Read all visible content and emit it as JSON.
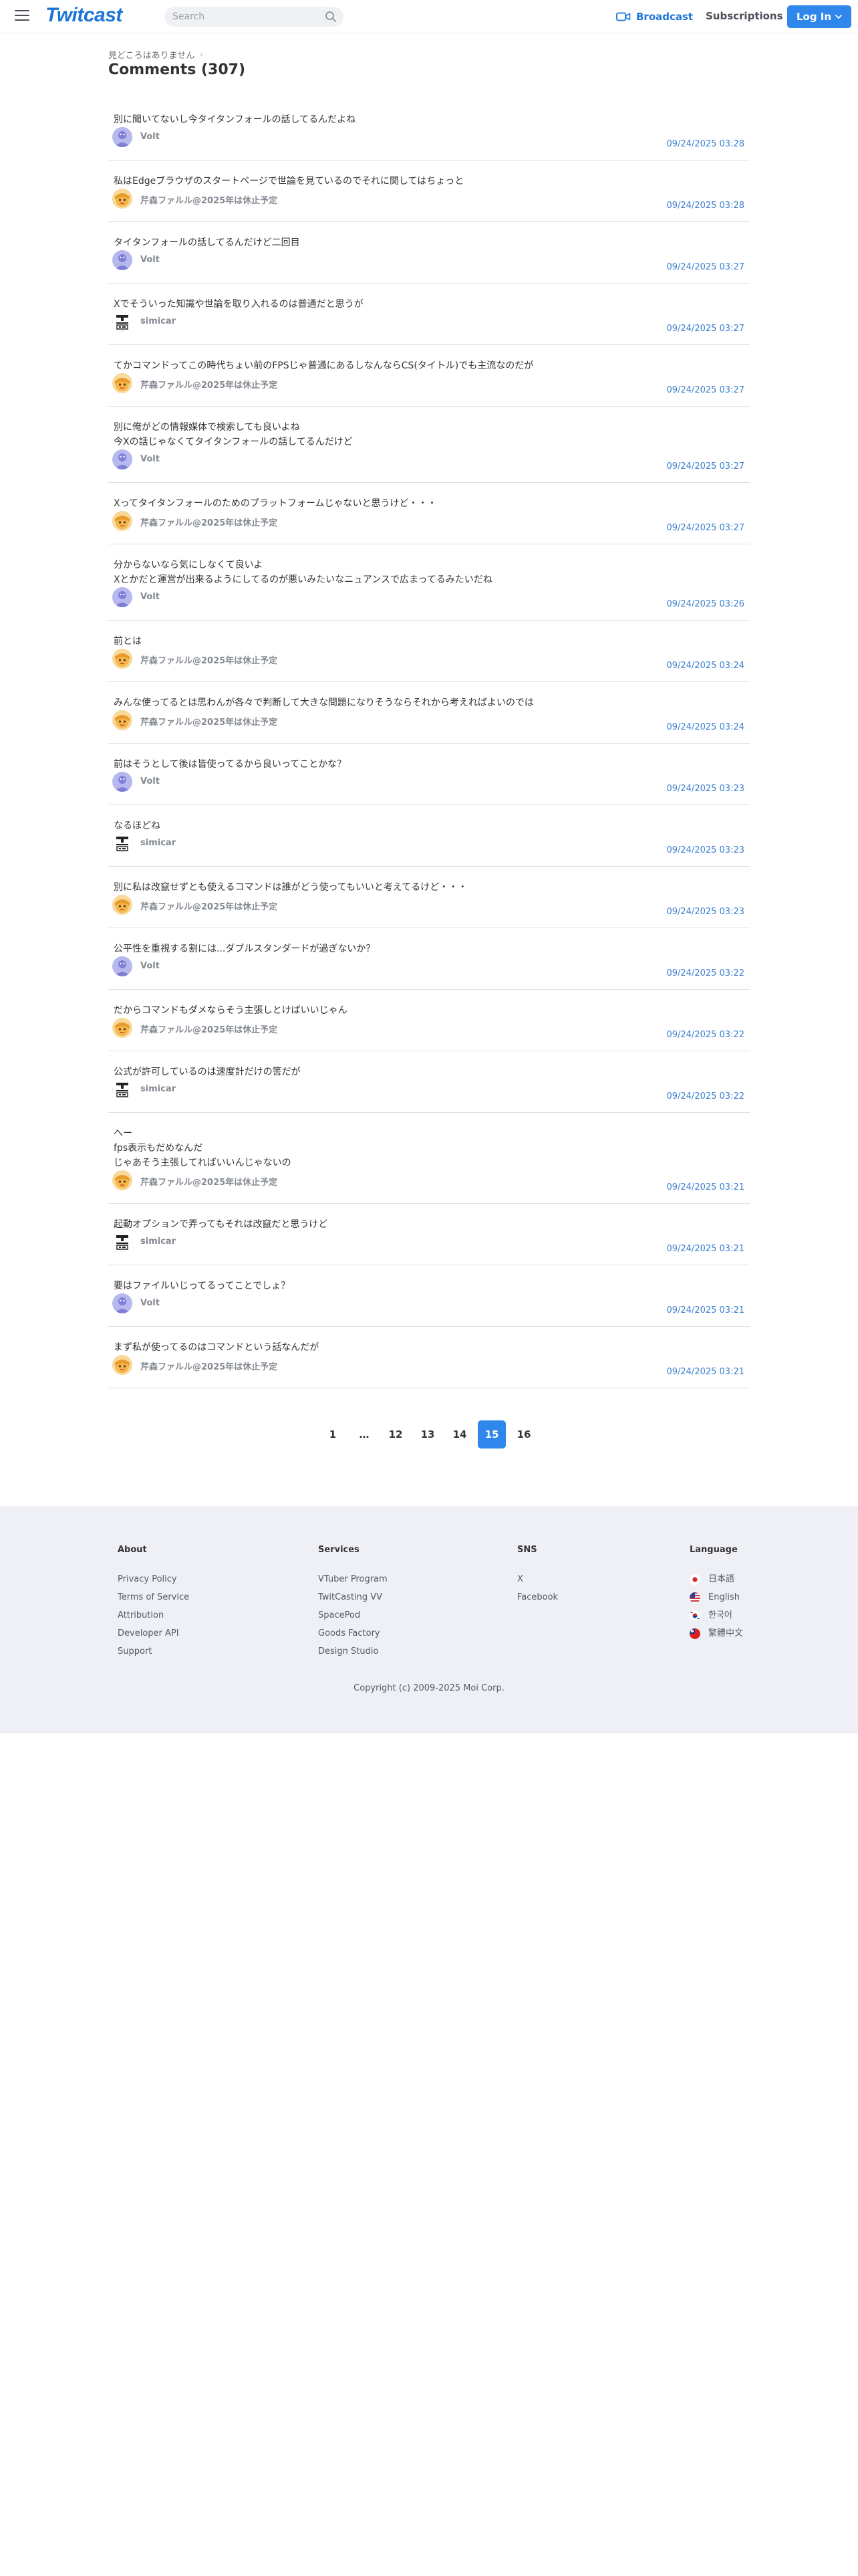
{
  "header": {
    "logo": "Twitcast",
    "search_placeholder": "Search",
    "broadcast_label": "Broadcast",
    "subscriptions_label": "Subscriptions",
    "login_label": "Log In"
  },
  "breadcrumb": {
    "label": "見どころはありません"
  },
  "page_title": "Comments (307)",
  "comments": [
    {
      "text": "別に聞いてないし今タイタンフォールの話してるんだよね",
      "user": "Volt",
      "avatar": "volt",
      "time": "09/24/2025 03:28"
    },
    {
      "text": "私はEdgeブラウザのスタートページで世論を見ているのでそれに関してはちょっと",
      "user": "芹森ファルル@2025年は休止予定",
      "avatar": "faruru",
      "time": "09/24/2025 03:28"
    },
    {
      "text": "タイタンフォールの話してるんだけど二回目",
      "user": "Volt",
      "avatar": "volt",
      "time": "09/24/2025 03:27"
    },
    {
      "text": "Xでそういった知識や世論を取り入れるのは普通だと思うが",
      "user": "simicar",
      "avatar": "simicar",
      "time": "09/24/2025 03:27"
    },
    {
      "text": "てかコマンドってこの時代ちょい前のFPSじゃ普通にあるしなんならCS(タイトル)でも主流なのだが",
      "user": "芹森ファルル@2025年は休止予定",
      "avatar": "faruru",
      "time": "09/24/2025 03:27"
    },
    {
      "text": "別に俺がどの情報媒体で検索しても良いよね\n今Xの話じゃなくてタイタンフォールの話してるんだけど",
      "user": "Volt",
      "avatar": "volt",
      "time": "09/24/2025 03:27"
    },
    {
      "text": "Xってタイタンフォールのためのプラットフォームじゃないと思うけど・・・",
      "user": "芹森ファルル@2025年は休止予定",
      "avatar": "faruru",
      "time": "09/24/2025 03:27"
    },
    {
      "text": "分からないなら気にしなくて良いよ\nXとかだと運営が出来るようにしてるのが悪いみたいなニュアンスで広まってるみたいだね",
      "user": "Volt",
      "avatar": "volt",
      "time": "09/24/2025 03:26"
    },
    {
      "text": "前とは",
      "user": "芹森ファルル@2025年は休止予定",
      "avatar": "faruru",
      "time": "09/24/2025 03:24"
    },
    {
      "text": "みんな使ってるとは思わんが各々で判断して大きな問題になりそうならそれから考えればよいのでは",
      "user": "芹森ファルル@2025年は休止予定",
      "avatar": "faruru",
      "time": "09/24/2025 03:24"
    },
    {
      "text": "前はそうとして後は皆使ってるから良いってことかな？",
      "user": "Volt",
      "avatar": "volt",
      "time": "09/24/2025 03:23"
    },
    {
      "text": "なるほどね",
      "user": "simicar",
      "avatar": "simicar",
      "time": "09/24/2025 03:23"
    },
    {
      "text": "別に私は改竄せずとも使えるコマンドは誰がどう使ってもいいと考えてるけど・・・",
      "user": "芹森ファルル@2025年は休止予定",
      "avatar": "faruru",
      "time": "09/24/2025 03:23"
    },
    {
      "text": "公平性を重視する割には...ダブルスタンダードが過ぎないか？",
      "user": "Volt",
      "avatar": "volt",
      "time": "09/24/2025 03:22"
    },
    {
      "text": "だからコマンドもダメならそう主張しとけばいいじゃん",
      "user": "芹森ファルル@2025年は休止予定",
      "avatar": "faruru",
      "time": "09/24/2025 03:22"
    },
    {
      "text": "公式が許可しているのは速度計だけの筈だが",
      "user": "simicar",
      "avatar": "simicar",
      "time": "09/24/2025 03:22"
    },
    {
      "text": "へー\nfps表示もだめなんだ\nじゃあそう主張してればいいんじゃないの",
      "user": "芹森ファルル@2025年は休止予定",
      "avatar": "faruru",
      "time": "09/24/2025 03:21"
    },
    {
      "text": "起動オプションで弄ってもそれは改竄だと思うけど",
      "user": "simicar",
      "avatar": "simicar",
      "time": "09/24/2025 03:21"
    },
    {
      "text": "要はファイルいじってるってことでしょ？",
      "user": "Volt",
      "avatar": "volt",
      "time": "09/24/2025 03:21"
    },
    {
      "text": "まず私が使ってるのはコマンドという話なんだが",
      "user": "芹森ファルル@2025年は休止予定",
      "avatar": "faruru",
      "time": "09/24/2025 03:21"
    }
  ],
  "pagination": {
    "pages": [
      "1",
      "…",
      "12",
      "13",
      "14",
      "15",
      "16"
    ],
    "current": "15"
  },
  "footer": {
    "about": {
      "heading": "About",
      "links": [
        "Privacy Policy",
        "Terms of Service",
        "Attribution",
        "Developer API",
        "Support"
      ]
    },
    "services": {
      "heading": "Services",
      "links": [
        "VTuber Program",
        "TwitCasting VV",
        "SpacePod",
        "Goods Factory",
        "Design Studio"
      ]
    },
    "sns": {
      "heading": "SNS",
      "links": [
        "X",
        "Facebook"
      ]
    },
    "language": {
      "heading": "Language",
      "links": [
        "日本語",
        "English",
        "한국어",
        "繁體中文"
      ]
    },
    "copyright": "Copyright (c) 2009-2025 Moi Corp."
  },
  "colors": {
    "accent": "#2f86eb",
    "link": "#3a7fd0",
    "footer_bg": "#eef0f5"
  }
}
